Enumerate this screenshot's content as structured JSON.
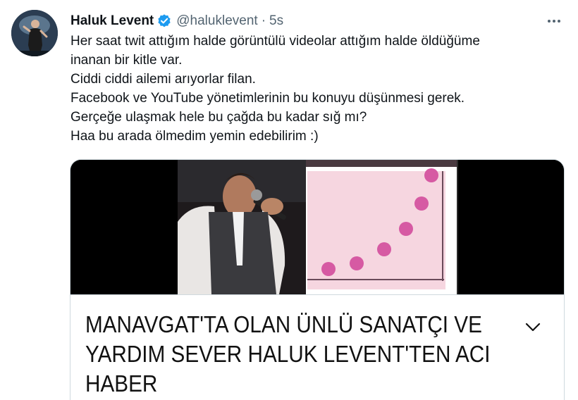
{
  "tweet": {
    "author": {
      "display_name": "Haluk Levent",
      "handle": "@haluklevent",
      "verified": true
    },
    "separator": "·",
    "timestamp": "5s",
    "text_lines": [
      "Her saat twit attığım halde görüntülü videolar attığım halde öldüğüme",
      "inanan bir kitle var.",
      "Ciddi ciddi ailemi arıyorlar filan.",
      "Facebook ve YouTube yönetimlerinin bu konuyu düşünmesi gerek.",
      "Gerçeğe ulaşmak hele bu çağda bu kadar sığ mı?",
      "Haa bu arada ölmedim yemin edebilirim :)"
    ]
  },
  "card": {
    "headline_lines": [
      "MANAVGAT'TA OLAN ÜNLÜ SANATÇI VE",
      "YARDIM SEVER HALUK LEVENT'TEN ACI",
      "HABER"
    ]
  },
  "icons": {
    "verified": "verified-badge-icon",
    "more": "more-options-icon",
    "chevron": "chevron-down-icon"
  },
  "colors": {
    "text_primary": "#0f1419",
    "text_secondary": "#536471",
    "verified_blue": "#1d9bf0",
    "border": "#cfd9de",
    "media_bg": "#000000",
    "chart_pink": "#f6d6e0",
    "dot_magenta": "#d65aa3"
  }
}
